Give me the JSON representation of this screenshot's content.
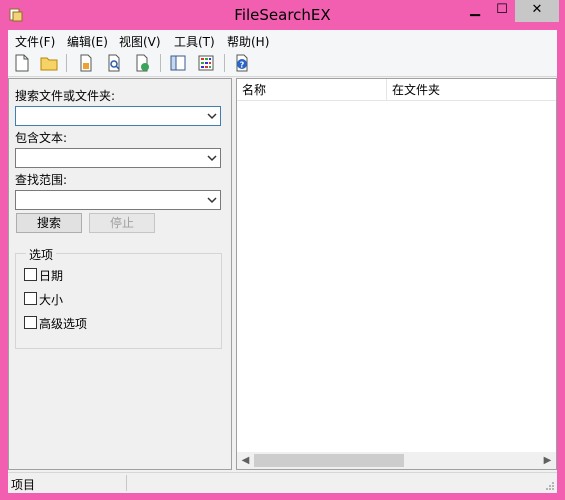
{
  "window": {
    "title": "FileSearchEX",
    "controls": {
      "minimize": "▁",
      "maximize": "☐",
      "close": "✕"
    }
  },
  "menu": [
    {
      "label": "文件(F)"
    },
    {
      "label": "编辑(E)"
    },
    {
      "label": "视图(V)"
    },
    {
      "label": "工具(T)"
    },
    {
      "label": "帮助(H)"
    }
  ],
  "toolbar": {
    "buttons": [
      "new-file-icon",
      "open-folder-icon",
      "document-icon",
      "document-search-icon",
      "document-export-icon",
      "panel-layout-icon",
      "grid-view-icon",
      "help-icon"
    ]
  },
  "search": {
    "name_label": "搜索文件或文件夹:",
    "name_value": "",
    "text_label": "包含文本:",
    "text_value": "",
    "scope_label": "查找范围:",
    "scope_value": "",
    "search_button": "搜索",
    "stop_button": "停止"
  },
  "options": {
    "title": "选项",
    "items": [
      {
        "label": "日期",
        "checked": false
      },
      {
        "label": "大小",
        "checked": false
      },
      {
        "label": "高级选项",
        "checked": false
      }
    ]
  },
  "results": {
    "columns": [
      "名称",
      "在文件夹"
    ],
    "rows": []
  },
  "status": {
    "text": "项目"
  },
  "colors": {
    "frame": "#f25fb0",
    "client": "#f0f0f0",
    "accent": "#3c7fb1"
  }
}
